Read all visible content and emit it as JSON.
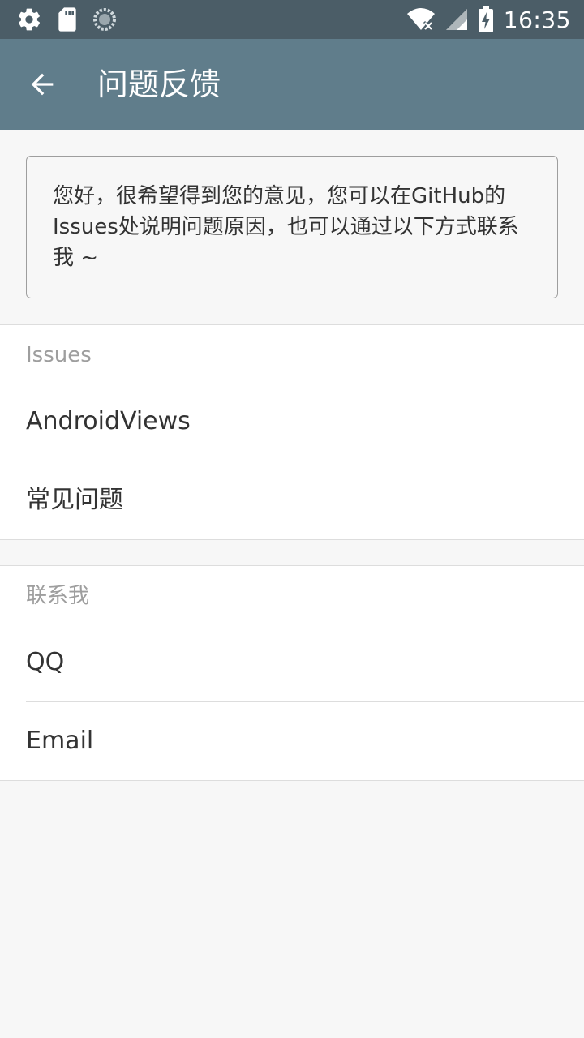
{
  "status_bar": {
    "time": "16:35",
    "icons": [
      "gear-icon",
      "sd-card-icon",
      "sync-spinner-icon",
      "wifi-off-icon",
      "signal-icon",
      "battery-charging-icon"
    ]
  },
  "app_bar": {
    "title": "问题反馈",
    "back_icon": "arrow-left-icon"
  },
  "intro": {
    "text": "您好，很希望得到您的意见，您可以在GitHub的Issues处说明问题原因，也可以通过以下方式联系我 ~"
  },
  "sections": [
    {
      "header": "Issues",
      "items": [
        {
          "label": "AndroidViews"
        },
        {
          "label": "常见问题"
        }
      ]
    },
    {
      "header": "联系我",
      "items": [
        {
          "label": "QQ"
        },
        {
          "label": "Email"
        }
      ]
    }
  ],
  "colors": {
    "status_bar": "#4b5d67",
    "app_bar": "#607d8b",
    "background": "#f7f7f7",
    "section_header_text": "#9e9e9e",
    "item_text": "#333333"
  }
}
